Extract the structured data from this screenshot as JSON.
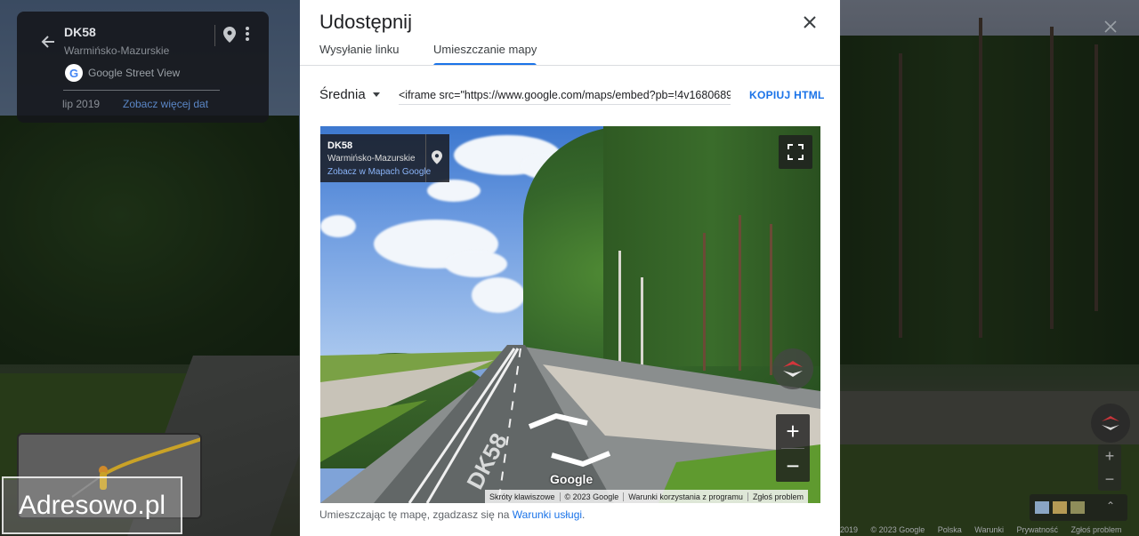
{
  "background": {
    "info_card": {
      "title": "DK58",
      "subtitle": "Warmińsko-Mazurskie",
      "source": "Google Street View",
      "date": "lip 2019",
      "more_dates_link": "Zobacz więcej dat"
    },
    "watermark": "Adresowo.pl",
    "footer": [
      "2019",
      "© 2023 Google",
      "Polska",
      "Warunki",
      "Prywatność",
      "Zgłoś problem"
    ]
  },
  "dialog": {
    "title": "Udostępnij",
    "tabs": [
      {
        "label": "Wysyłanie linku",
        "active": false
      },
      {
        "label": "Umieszczanie mapy",
        "active": true
      }
    ],
    "size_select": "Średnia",
    "embed_code": "<iframe src=\"https://www.google.com/maps/embed?pb=!4v1680689",
    "copy_button": "KOPIUJ HTML",
    "preview": {
      "title": "DK58",
      "subtitle": "Warmińsko-Mazurskie",
      "maps_link": "Zobacz w Mapach Google",
      "road_marking": "DK58",
      "google_logo": "Google",
      "zoom_in": "+",
      "zoom_out": "−",
      "footer": [
        "Skróty klawiszowe",
        "© 2023 Google",
        "Warunki korzystania z programu",
        "Zgłoś problem"
      ]
    },
    "terms_prefix": "Umieszczając tę mapę, zgadzasz się na",
    "terms_link": "Warunki usługi",
    "terms_suffix": "."
  },
  "colors": {
    "accent": "#1a73e8",
    "link_dark": "#5b87c7"
  },
  "icons": [
    "back-arrow-icon",
    "pin-icon",
    "more-vert-icon",
    "google-g-icon",
    "close-icon",
    "fullscreen-icon",
    "compass-icon",
    "caret-down-icon"
  ]
}
